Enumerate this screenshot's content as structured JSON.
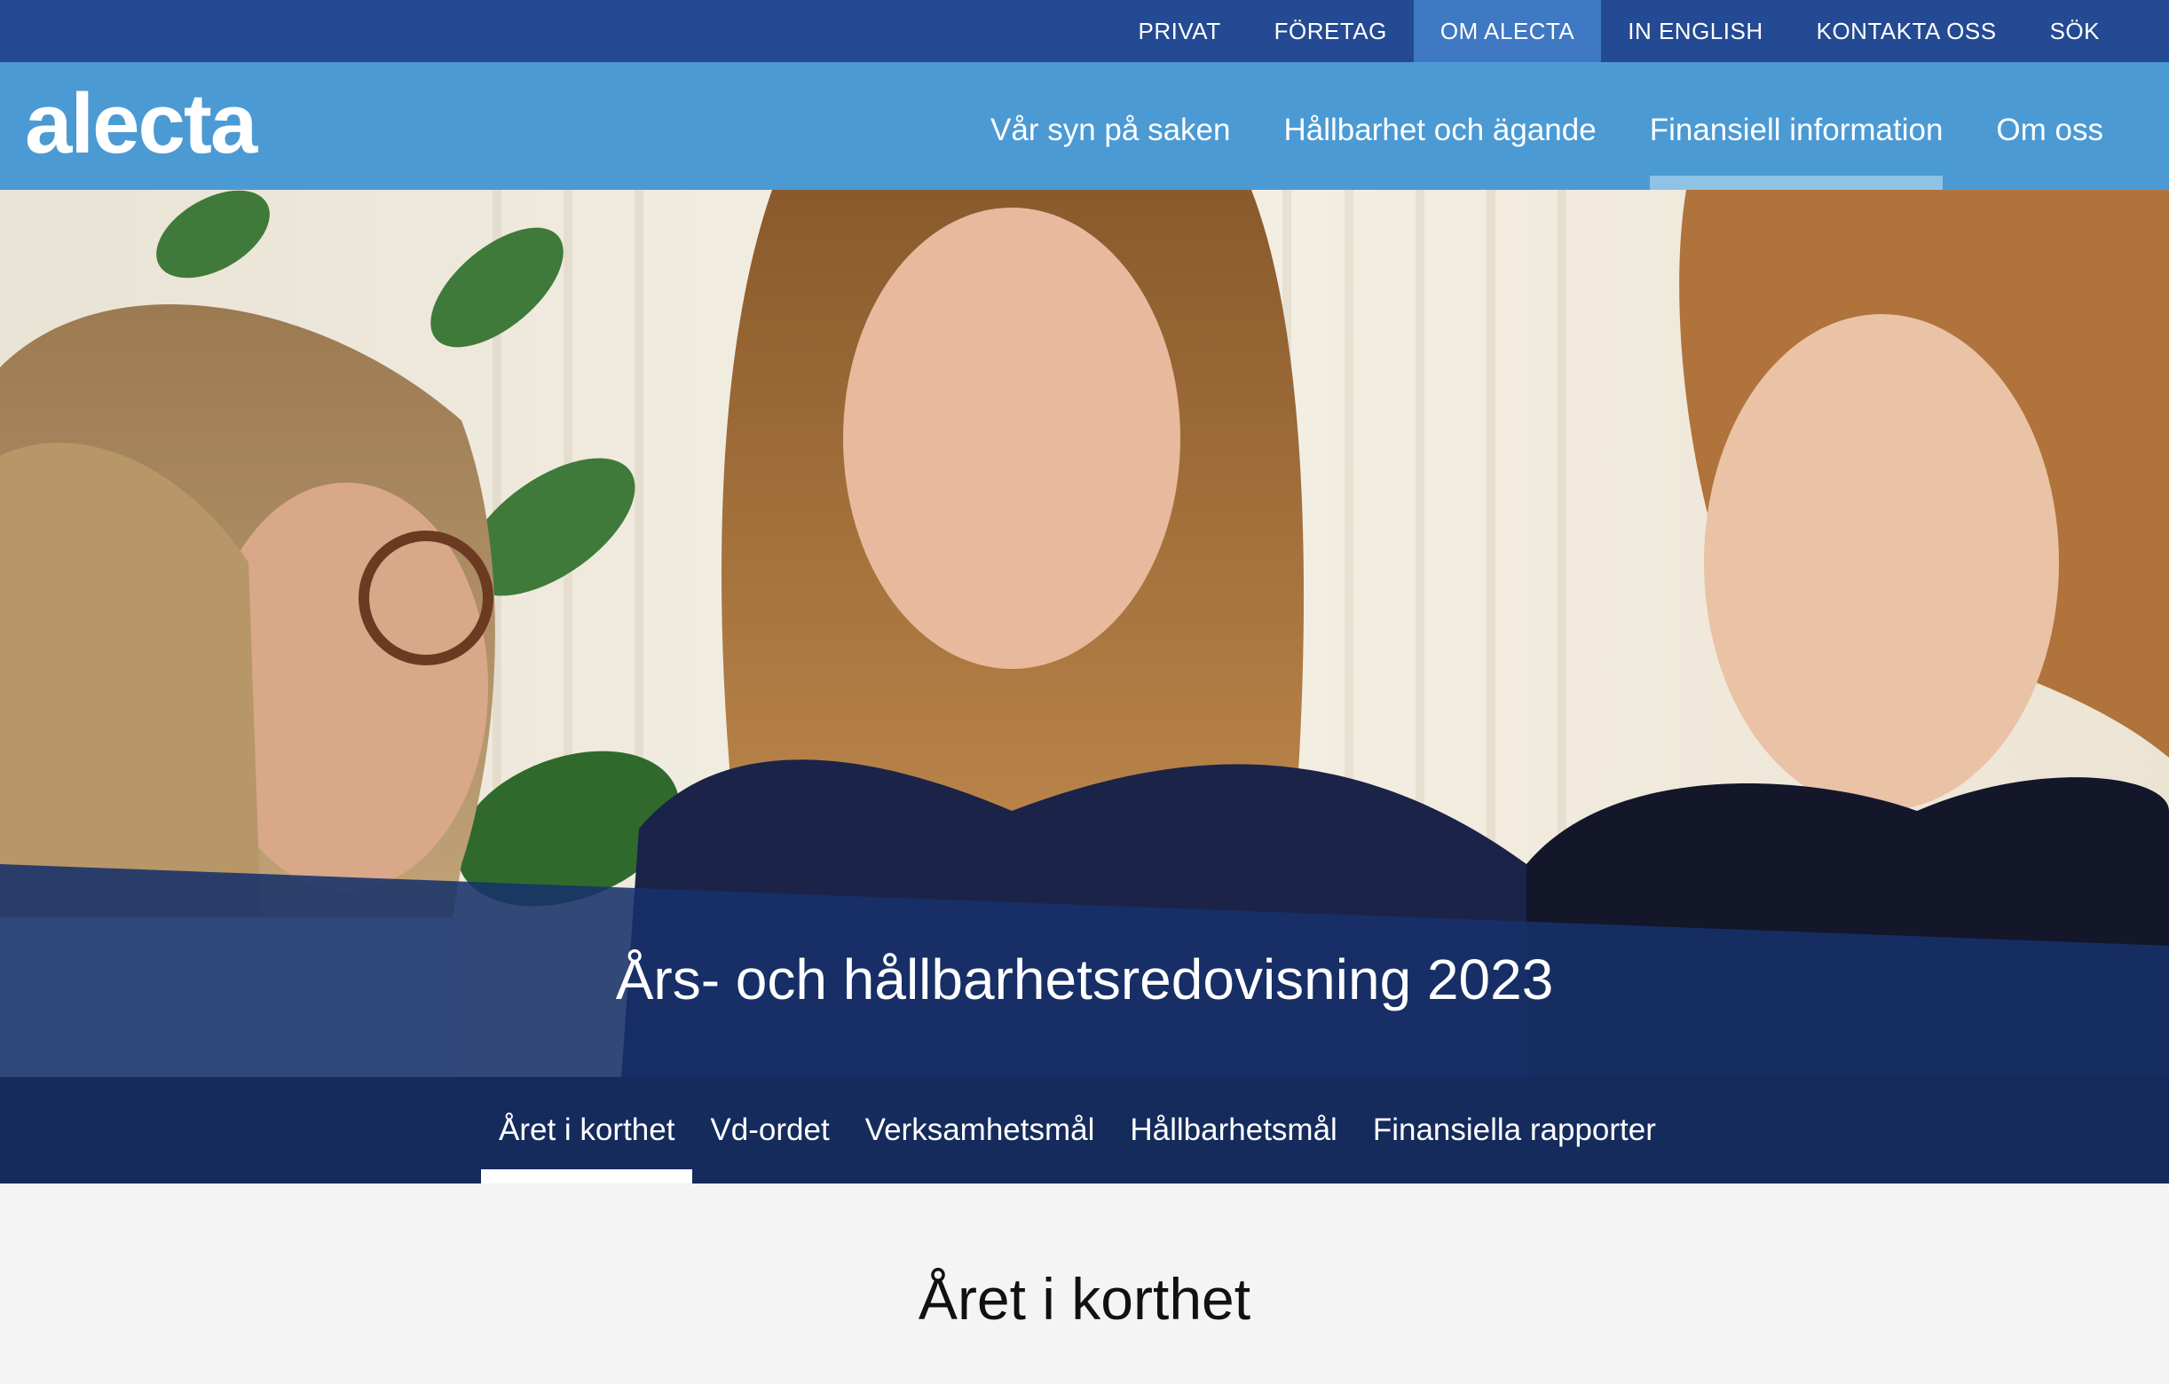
{
  "topbar": {
    "links": [
      {
        "label": "PRIVAT",
        "active": false
      },
      {
        "label": "FÖRETAG",
        "active": false
      },
      {
        "label": "OM ALECTA",
        "active": true
      },
      {
        "label": "IN ENGLISH",
        "active": false
      },
      {
        "label": "KONTAKTA OSS",
        "active": false
      },
      {
        "label": "SÖK",
        "active": false
      }
    ]
  },
  "header": {
    "logo_text": "alecta",
    "nav": [
      {
        "label": "Vår syn på saken",
        "active": false
      },
      {
        "label": "Hållbarhet och ägande",
        "active": false
      },
      {
        "label": "Finansiell information",
        "active": true
      },
      {
        "label": "Om oss",
        "active": false
      }
    ]
  },
  "hero": {
    "title": "Års- och hållbarhetsredovisning 2023",
    "image": "photo-three-women"
  },
  "subnav": {
    "items": [
      {
        "label": "Året i korthet",
        "active": true
      },
      {
        "label": "Vd-ordet",
        "active": false
      },
      {
        "label": "Verksamhetsmål",
        "active": false
      },
      {
        "label": "Hållbarhetsmål",
        "active": false
      },
      {
        "label": "Finansiella rapporter",
        "active": false
      }
    ]
  },
  "content": {
    "heading": "Året i korthet"
  },
  "colors": {
    "topbar": "#244a93",
    "topbar_active": "#3f78c3",
    "header": "#4b9ad4",
    "nav_underline": "#8ec3e6",
    "subnav": "#152b5c",
    "hero_overlay": "#17316a"
  }
}
